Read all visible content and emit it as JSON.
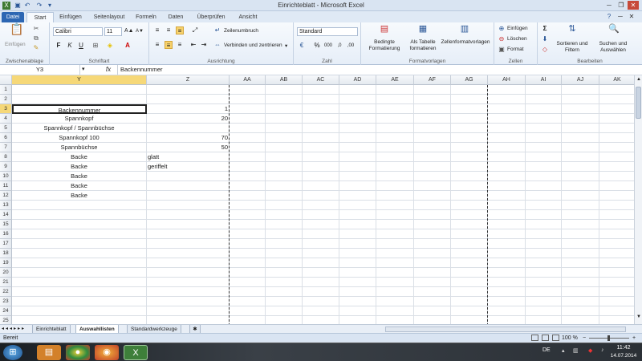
{
  "window": {
    "title": "Einrichteblatt - Microsoft Excel"
  },
  "tabs": [
    "Datei",
    "Start",
    "Einfügen",
    "Seitenlayout",
    "Formeln",
    "Daten",
    "Überprüfen",
    "Ansicht"
  ],
  "ribbon": {
    "clipboard": {
      "label": "Zwischenablage",
      "paste": "Einfügen"
    },
    "font": {
      "label": "Schriftart",
      "name": "Calibri",
      "size": "11",
      "bold": "F",
      "italic": "K",
      "underline": "U"
    },
    "alignment": {
      "label": "Ausrichtung",
      "wrap": "Zeilenumbruch",
      "merge": "Verbinden und zentrieren"
    },
    "number": {
      "label": "Zahl",
      "format": "Standard",
      "percent": "%",
      "thousands": "000"
    },
    "styles": {
      "label": "Formatvorlagen",
      "conditional": "Bedingte Formatierung",
      "astable": "Als Tabelle formatieren",
      "cellstyles": "Zellenformatvorlagen"
    },
    "cells": {
      "label": "Zellen",
      "insert": "Einfügen",
      "delete": "Löschen",
      "format": "Format"
    },
    "editing": {
      "label": "Bearbeiten",
      "sort": "Sortieren und Filtern",
      "find": "Suchen und Auswählen"
    }
  },
  "formula_bar": {
    "namebox": "Y3",
    "fx": "fx",
    "content": "Backennummer"
  },
  "columns": [
    "Y",
    "Z",
    "AA",
    "AB",
    "AC",
    "AD",
    "AE",
    "AF",
    "AG",
    "AH",
    "AI",
    "AJ",
    "AK"
  ],
  "rows": [
    "1",
    "2",
    "3",
    "4",
    "5",
    "6",
    "7",
    "8",
    "9",
    "10",
    "11",
    "12",
    "13",
    "14",
    "15",
    "16",
    "17",
    "18",
    "19",
    "20",
    "21",
    "22",
    "23",
    "24",
    "25"
  ],
  "cells": {
    "Y3": "Backennummer",
    "Z3": "1",
    "Y4": "Spannkopf",
    "Z4": "20",
    "Y5": "Spannkopf / Spannbüchse",
    "Y6": "Spannkopf 100",
    "Z6": "70",
    "Y7": "Spannbüchse",
    "Z7": "50",
    "Y8": "Backe",
    "Z8": "glatt",
    "Y9": "Backe",
    "Z9": "geriffelt",
    "Y10": "Backe",
    "Y11": "Backe",
    "Y12": "Backe"
  },
  "sheet_tabs": [
    "Einrichteblatt",
    "Auswahllisten",
    "Standardwerkzeuge"
  ],
  "active_sheet": "Auswahllisten",
  "status": {
    "ready": "Bereit",
    "zoom": "100 %"
  },
  "taskbar": {
    "lang": "DE",
    "time": "11:42",
    "date": "14.07.2014"
  },
  "colors": {
    "file_tab": "#2c66b3",
    "active_header": "#f6d878",
    "ribbon_bg": "#e6eef8"
  }
}
